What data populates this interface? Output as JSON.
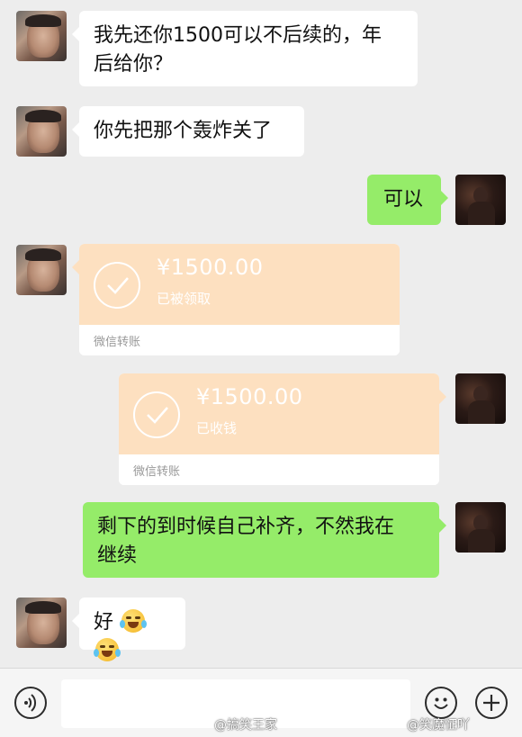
{
  "messages": {
    "m1": {
      "line1": "我先还你1500可以不后续的，年",
      "line2": "后给你？"
    },
    "m2": "你先把那个轰炸关了",
    "m3": "可以",
    "t1": {
      "amount": "¥1500.00",
      "status": "已被领取",
      "label": "微信转账"
    },
    "t2": {
      "amount": "¥1500.00",
      "status": "已收钱",
      "label": "微信转账"
    },
    "m4": {
      "line1": "剩下的到时候自己补齐，不然我在",
      "line2": "继续"
    },
    "m5": "好"
  },
  "bottom_bar": {
    "input_placeholder": ""
  },
  "watermarks": {
    "left": "@搞笑王家",
    "right": "@笑魔怔吖"
  },
  "colors": {
    "incoming_bubble": "#ffffff",
    "outgoing_bubble": "#95ec69",
    "transfer_card": "#fde0c0",
    "background": "#ededed"
  },
  "icons": {
    "voice": "voice-icon",
    "emoji": "emoji-icon",
    "more": "plus-icon",
    "crying_laughing": "crying-laughing-emoji-icon"
  }
}
